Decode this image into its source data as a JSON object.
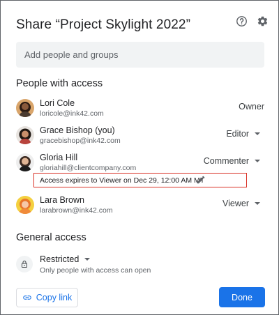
{
  "dialog": {
    "title": "Share “Project Skylight 2022”",
    "help_icon": "help-circle-icon",
    "settings_icon": "gear-icon"
  },
  "add_people": {
    "placeholder": "Add people and groups",
    "value": ""
  },
  "people_section": {
    "title": "People with access",
    "people": [
      {
        "name": "Lori Cole",
        "email": "loricole@ink42.com",
        "role": "Owner"
      },
      {
        "name": "Grace Bishop (you)",
        "email": "gracebishop@ink42.com",
        "role": "Editor"
      },
      {
        "name": "Gloria Hill",
        "email": "gloriahill@clientcompany.com",
        "role": "Commenter",
        "expiry_note": "Access expires to Viewer on Dec 29, 12:00 AM MT"
      },
      {
        "name": "Lara Brown",
        "email": "larabrown@ink42.com",
        "role": "Viewer"
      }
    ]
  },
  "general_access": {
    "title": "General access",
    "setting": "Restricted",
    "description": "Only people with access can open"
  },
  "footer": {
    "copy_link_label": "Copy link",
    "done_label": "Done"
  },
  "colors": {
    "accent": "#1a73e8",
    "highlight_border": "#d93025",
    "input_bg": "#f1f3f4"
  }
}
